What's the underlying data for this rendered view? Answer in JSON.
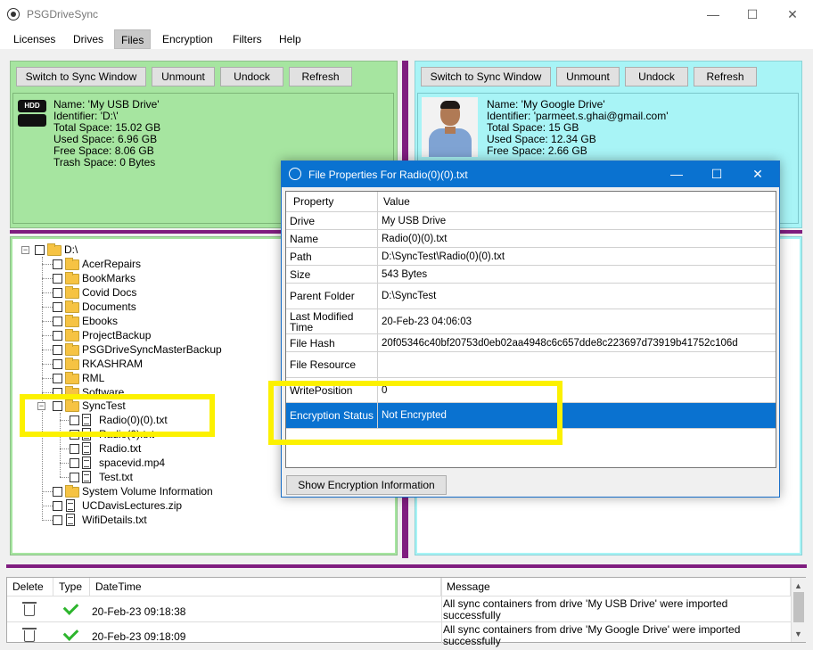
{
  "window": {
    "title": "PSGDriveSync",
    "minimize": "—",
    "maximize": "☐",
    "close": "✕"
  },
  "menu": [
    "Licenses",
    "Drives",
    "Files",
    "Encryption",
    "Filters",
    "Help"
  ],
  "left_panel": {
    "buttons": [
      "Switch to Sync Window",
      "Unmount",
      "Undock",
      "Refresh"
    ],
    "icon_label": "HDD",
    "info": "Name: 'My USB Drive'\nIdentifier: 'D:\\'\nTotal Space: 15.02 GB\nUsed Space: 6.96 GB\nFree Space: 8.06 GB\nTrash Space: 0 Bytes"
  },
  "right_panel": {
    "buttons": [
      "Switch to Sync Window",
      "Unmount",
      "Undock",
      "Refresh"
    ],
    "info": "Name: 'My Google Drive'\nIdentifier: 'parmeet.s.ghai@gmail.com'\nTotal Space: 15 GB\nUsed Space: 12.34 GB\nFree Space: 2.66 GB"
  },
  "tree": {
    "root": "D:\\",
    "folders": [
      "AcerRepairs",
      "BookMarks",
      "Covid Docs",
      "Documents",
      "Ebooks",
      "ProjectBackup",
      "PSGDriveSyncMasterBackup",
      "RKASHRAM",
      "RML",
      "Software"
    ],
    "synctest": "SyncTest",
    "synctest_files": [
      "Radio(0)(0).txt",
      "Radio(0).txt",
      "Radio.txt",
      "spacevid.mp4",
      "Test.txt"
    ],
    "after": [
      {
        "name": "System Volume Information",
        "kind": "folder"
      },
      {
        "name": "UCDavisLectures.zip",
        "kind": "file"
      },
      {
        "name": "WifiDetails.txt",
        "kind": "file"
      }
    ]
  },
  "dialog": {
    "title": "File Properties For Radio(0)(0).txt",
    "minimize": "—",
    "maximize": "☐",
    "close": "✕",
    "header": {
      "property": "Property",
      "value": "Value"
    },
    "rows": [
      {
        "property": "Drive",
        "value": "My USB Drive"
      },
      {
        "property": "Name",
        "value": "Radio(0)(0).txt"
      },
      {
        "property": "Path",
        "value": "D:\\SyncTest\\Radio(0)(0).txt"
      },
      {
        "property": "Size",
        "value": "543 Bytes"
      },
      {
        "property": "Parent Folder",
        "value": "D:\\SyncTest"
      },
      {
        "property": "Last Modified Time",
        "value": "20-Feb-23 04:06:03"
      },
      {
        "property": "File Hash",
        "value": "20f05346c40bf20753d0eb02aa4948c6c657dde8c223697d73919b41752c106d"
      },
      {
        "property": "File Resource",
        "value": ""
      },
      {
        "property": "WritePosition",
        "value": "0"
      },
      {
        "property": "Encryption Status",
        "value": "Not Encrypted"
      }
    ],
    "show_button": "Show Encryption Information"
  },
  "log": {
    "columns": [
      "Delete",
      "Type",
      "DateTime",
      "Message"
    ],
    "rows": [
      {
        "datetime": "20-Feb-23 09:18:38",
        "message": "All sync containers from drive 'My USB Drive' were imported successfully"
      },
      {
        "datetime": "20-Feb-23 09:18:09",
        "message": "All sync containers from drive 'My Google Drive' were imported successfully"
      }
    ]
  },
  "colors": {
    "left_panel": "#a6e5a0",
    "right_panel": "#a8f4f6",
    "divider": "#7f1d7f",
    "selection": "#0a72d0",
    "highlight": "#fcf100"
  }
}
